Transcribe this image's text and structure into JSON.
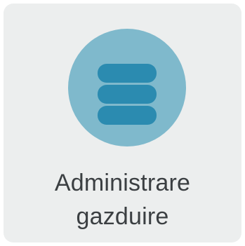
{
  "tile": {
    "label_line1": "Administrare",
    "label_line2": "gazduire",
    "icon": "database-icon",
    "colors": {
      "tile_background": "#eceeee",
      "icon_circle": "#7fb9cc",
      "icon_glyph": "#2b8bb0",
      "text": "#3b3f42"
    }
  }
}
